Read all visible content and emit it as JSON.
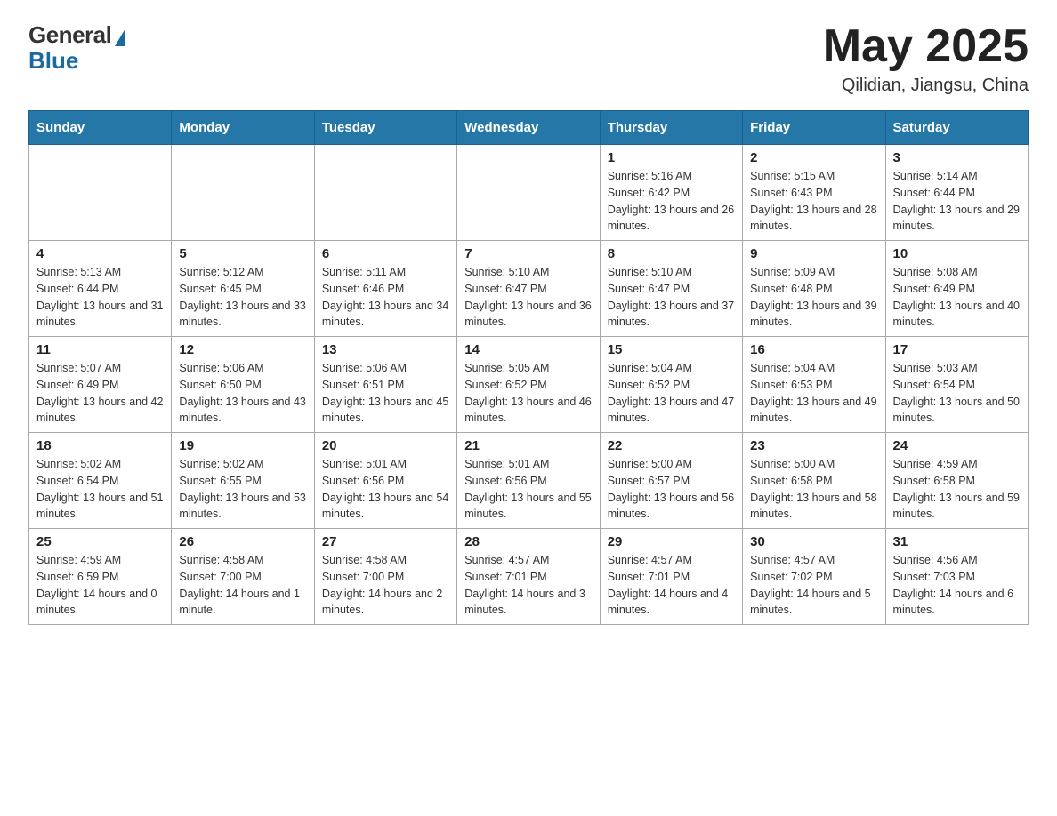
{
  "logo": {
    "general": "General",
    "blue": "Blue"
  },
  "header": {
    "month": "May 2025",
    "location": "Qilidian, Jiangsu, China"
  },
  "days_of_week": [
    "Sunday",
    "Monday",
    "Tuesday",
    "Wednesday",
    "Thursday",
    "Friday",
    "Saturday"
  ],
  "weeks": [
    [
      {
        "day": "",
        "info": ""
      },
      {
        "day": "",
        "info": ""
      },
      {
        "day": "",
        "info": ""
      },
      {
        "day": "",
        "info": ""
      },
      {
        "day": "1",
        "info": "Sunrise: 5:16 AM\nSunset: 6:42 PM\nDaylight: 13 hours and 26 minutes."
      },
      {
        "day": "2",
        "info": "Sunrise: 5:15 AM\nSunset: 6:43 PM\nDaylight: 13 hours and 28 minutes."
      },
      {
        "day": "3",
        "info": "Sunrise: 5:14 AM\nSunset: 6:44 PM\nDaylight: 13 hours and 29 minutes."
      }
    ],
    [
      {
        "day": "4",
        "info": "Sunrise: 5:13 AM\nSunset: 6:44 PM\nDaylight: 13 hours and 31 minutes."
      },
      {
        "day": "5",
        "info": "Sunrise: 5:12 AM\nSunset: 6:45 PM\nDaylight: 13 hours and 33 minutes."
      },
      {
        "day": "6",
        "info": "Sunrise: 5:11 AM\nSunset: 6:46 PM\nDaylight: 13 hours and 34 minutes."
      },
      {
        "day": "7",
        "info": "Sunrise: 5:10 AM\nSunset: 6:47 PM\nDaylight: 13 hours and 36 minutes."
      },
      {
        "day": "8",
        "info": "Sunrise: 5:10 AM\nSunset: 6:47 PM\nDaylight: 13 hours and 37 minutes."
      },
      {
        "day": "9",
        "info": "Sunrise: 5:09 AM\nSunset: 6:48 PM\nDaylight: 13 hours and 39 minutes."
      },
      {
        "day": "10",
        "info": "Sunrise: 5:08 AM\nSunset: 6:49 PM\nDaylight: 13 hours and 40 minutes."
      }
    ],
    [
      {
        "day": "11",
        "info": "Sunrise: 5:07 AM\nSunset: 6:49 PM\nDaylight: 13 hours and 42 minutes."
      },
      {
        "day": "12",
        "info": "Sunrise: 5:06 AM\nSunset: 6:50 PM\nDaylight: 13 hours and 43 minutes."
      },
      {
        "day": "13",
        "info": "Sunrise: 5:06 AM\nSunset: 6:51 PM\nDaylight: 13 hours and 45 minutes."
      },
      {
        "day": "14",
        "info": "Sunrise: 5:05 AM\nSunset: 6:52 PM\nDaylight: 13 hours and 46 minutes."
      },
      {
        "day": "15",
        "info": "Sunrise: 5:04 AM\nSunset: 6:52 PM\nDaylight: 13 hours and 47 minutes."
      },
      {
        "day": "16",
        "info": "Sunrise: 5:04 AM\nSunset: 6:53 PM\nDaylight: 13 hours and 49 minutes."
      },
      {
        "day": "17",
        "info": "Sunrise: 5:03 AM\nSunset: 6:54 PM\nDaylight: 13 hours and 50 minutes."
      }
    ],
    [
      {
        "day": "18",
        "info": "Sunrise: 5:02 AM\nSunset: 6:54 PM\nDaylight: 13 hours and 51 minutes."
      },
      {
        "day": "19",
        "info": "Sunrise: 5:02 AM\nSunset: 6:55 PM\nDaylight: 13 hours and 53 minutes."
      },
      {
        "day": "20",
        "info": "Sunrise: 5:01 AM\nSunset: 6:56 PM\nDaylight: 13 hours and 54 minutes."
      },
      {
        "day": "21",
        "info": "Sunrise: 5:01 AM\nSunset: 6:56 PM\nDaylight: 13 hours and 55 minutes."
      },
      {
        "day": "22",
        "info": "Sunrise: 5:00 AM\nSunset: 6:57 PM\nDaylight: 13 hours and 56 minutes."
      },
      {
        "day": "23",
        "info": "Sunrise: 5:00 AM\nSunset: 6:58 PM\nDaylight: 13 hours and 58 minutes."
      },
      {
        "day": "24",
        "info": "Sunrise: 4:59 AM\nSunset: 6:58 PM\nDaylight: 13 hours and 59 minutes."
      }
    ],
    [
      {
        "day": "25",
        "info": "Sunrise: 4:59 AM\nSunset: 6:59 PM\nDaylight: 14 hours and 0 minutes."
      },
      {
        "day": "26",
        "info": "Sunrise: 4:58 AM\nSunset: 7:00 PM\nDaylight: 14 hours and 1 minute."
      },
      {
        "day": "27",
        "info": "Sunrise: 4:58 AM\nSunset: 7:00 PM\nDaylight: 14 hours and 2 minutes."
      },
      {
        "day": "28",
        "info": "Sunrise: 4:57 AM\nSunset: 7:01 PM\nDaylight: 14 hours and 3 minutes."
      },
      {
        "day": "29",
        "info": "Sunrise: 4:57 AM\nSunset: 7:01 PM\nDaylight: 14 hours and 4 minutes."
      },
      {
        "day": "30",
        "info": "Sunrise: 4:57 AM\nSunset: 7:02 PM\nDaylight: 14 hours and 5 minutes."
      },
      {
        "day": "31",
        "info": "Sunrise: 4:56 AM\nSunset: 7:03 PM\nDaylight: 14 hours and 6 minutes."
      }
    ]
  ]
}
